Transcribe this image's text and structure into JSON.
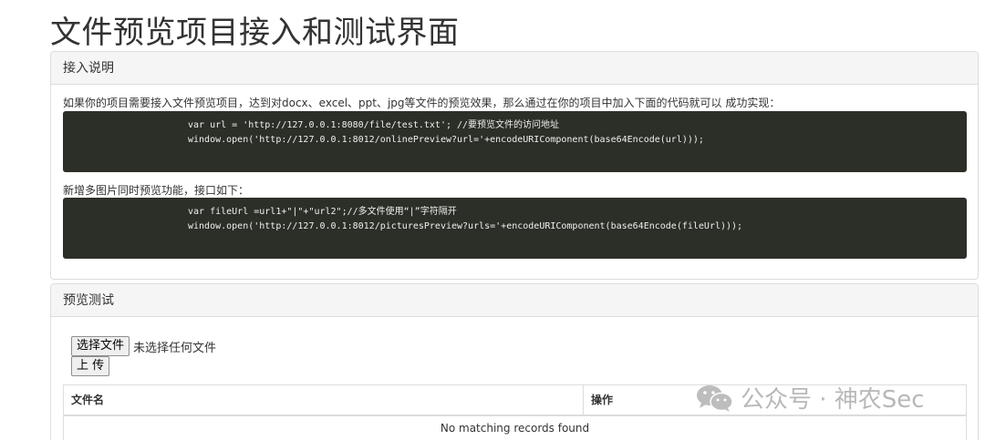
{
  "page": {
    "title": "文件预览项目接入和测试界面"
  },
  "integration": {
    "heading": "接入说明",
    "intro": "如果你的项目需要接入文件预览项目，达到对docx、excel、ppt、jpg等文件的预览效果，那么通过在你的项目中加入下面的代码就可以 成功实现：",
    "code1": [
      "var url = 'http://127.0.0.1:8080/file/test.txt'; //要预览文件的访问地址",
      "window.open('http://127.0.0.1:8012/onlinePreview?url='+encodeURIComponent(base64Encode(url)));"
    ],
    "multi_intro": "新增多图片同时预览功能，接口如下：",
    "code2": [
      "var fileUrl =url1+\"|\"+\"url2\";//多文件使用“|”字符隔开",
      "window.open('http://127.0.0.1:8012/picturesPreview?urls='+encodeURIComponent(base64Encode(fileUrl)));"
    ]
  },
  "preview_test": {
    "heading": "预览测试",
    "choose_file_label": "选择文件",
    "no_file_text": "未选择任何文件",
    "upload_label": "上 传",
    "table": {
      "columns": [
        "文件名",
        "操作"
      ],
      "empty_message": "No matching records found"
    }
  },
  "watermark": {
    "text": "公众号 · 神农Sec",
    "icon": "wechat-icon"
  }
}
